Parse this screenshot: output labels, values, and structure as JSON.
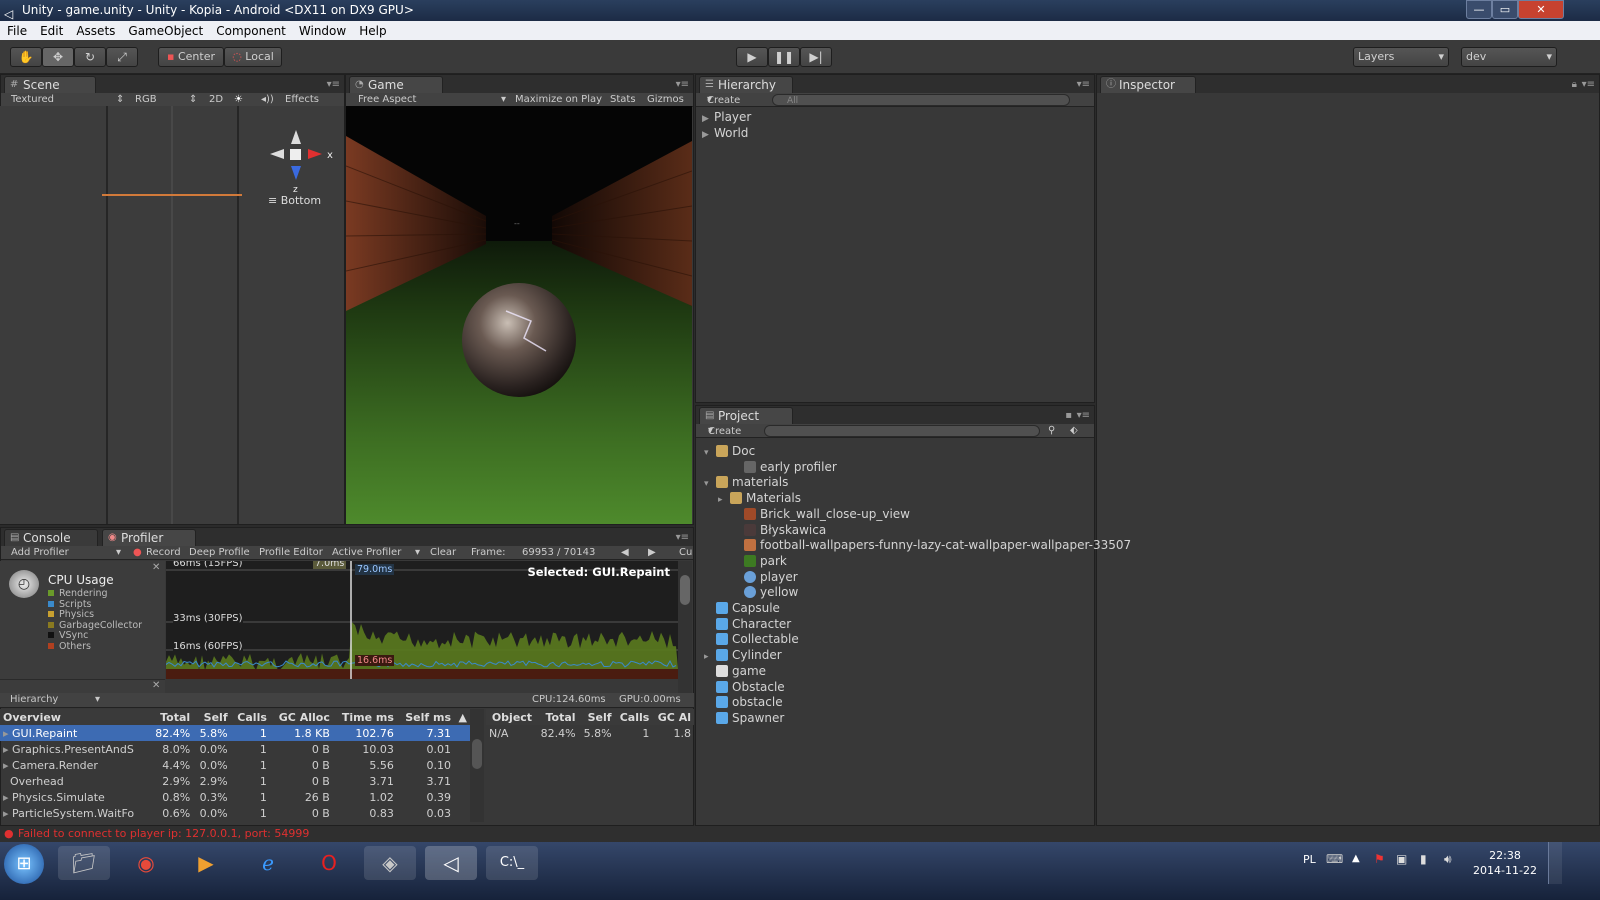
{
  "window": {
    "title": "Unity - game.unity - Unity - Kopia - Android <DX11 on DX9 GPU>",
    "buttons": {
      "minimize": "—",
      "maximize": "▭",
      "close": "✕"
    }
  },
  "menu": [
    "File",
    "Edit",
    "Assets",
    "GameObject",
    "Component",
    "Window",
    "Help"
  ],
  "toolbar": {
    "pivot": "Center",
    "space": "Local",
    "layers": "Layers",
    "layout": "dev"
  },
  "scene": {
    "tab": "Scene",
    "render_mode": "Textured",
    "color_mode": "RGB",
    "mode_2d": "2D",
    "effects": "Effects",
    "gizmo_label": "Bottom",
    "axis_x": "x",
    "axis_z": "z"
  },
  "game": {
    "tab": "Game",
    "aspect": "Free Aspect",
    "maximize": "Maximize on Play",
    "stats": "Stats",
    "gizmos": "Gizmos"
  },
  "hierarchy": {
    "tab": "Hierarchy",
    "create": "Create",
    "search_placeholder": "All",
    "items": [
      "Player",
      "World"
    ]
  },
  "inspector": {
    "tab": "Inspector"
  },
  "project": {
    "tab": "Project",
    "create": "Create",
    "items": [
      {
        "label": "Doc",
        "depth": 0,
        "type": "folder-open"
      },
      {
        "label": "early profiler",
        "depth": 2,
        "type": "file"
      },
      {
        "label": "materials",
        "depth": 0,
        "type": "folder-open"
      },
      {
        "label": "Materials",
        "depth": 1,
        "type": "folder-closed"
      },
      {
        "label": "Brick_wall_close-up_view",
        "depth": 2,
        "type": "texture-brick"
      },
      {
        "label": "Błyskawica",
        "depth": 2,
        "type": "texture-dark"
      },
      {
        "label": "football-wallpapers-funny-lazy-cat-wallpaper-wallpaper-33507",
        "depth": 2,
        "type": "texture-cat"
      },
      {
        "label": "park",
        "depth": 2,
        "type": "texture-grass"
      },
      {
        "label": "player",
        "depth": 2,
        "type": "material"
      },
      {
        "label": "yellow",
        "depth": 2,
        "type": "material"
      },
      {
        "label": "Capsule",
        "depth": 0,
        "type": "prefab"
      },
      {
        "label": "Character",
        "depth": 0,
        "type": "script"
      },
      {
        "label": "Collectable",
        "depth": 0,
        "type": "script"
      },
      {
        "label": "Cylinder",
        "depth": 0,
        "type": "prefab-collapsed"
      },
      {
        "label": "game",
        "depth": 0,
        "type": "scene"
      },
      {
        "label": "Obstacle",
        "depth": 0,
        "type": "script"
      },
      {
        "label": "obstacle",
        "depth": 0,
        "type": "prefab"
      },
      {
        "label": "Spawner",
        "depth": 0,
        "type": "script"
      }
    ]
  },
  "console": {
    "tab": "Console"
  },
  "profiler": {
    "tab": "Profiler",
    "add": "Add Profiler",
    "record": "Record",
    "deep": "Deep Profile",
    "editor": "Profile Editor",
    "active": "Active Profiler",
    "clear": "Clear",
    "frame_label": "Frame:",
    "frame_value": "69953 / 70143",
    "current": "Cu",
    "module": "CPU Usage",
    "legend": [
      {
        "label": "Rendering",
        "color": "#6a9a2a"
      },
      {
        "label": "Scripts",
        "color": "#3a8acb"
      },
      {
        "label": "Physics",
        "color": "#c8a030"
      },
      {
        "label": "GarbageCollector",
        "color": "#8a7a20"
      },
      {
        "label": "VSync",
        "color": "#111111"
      },
      {
        "label": "Others",
        "color": "#b04020"
      }
    ],
    "graph": {
      "line_66": "66ms (15FPS)",
      "line_33": "33ms (30FPS)",
      "line_16": "16ms (60FPS)",
      "marker_left": "7.0ms",
      "marker_right": "79.0ms",
      "marker_bottom": "16.6ms",
      "selected": "Selected: GUI.Repaint"
    },
    "view_mode": "Hierarchy",
    "cpu": "CPU:124.60ms",
    "gpu": "GPU:0.00ms",
    "columns": [
      "Overview",
      "Total",
      "Self",
      "Calls",
      "GC Alloc",
      "Time ms",
      "Self ms",
      "▲"
    ],
    "rows": [
      [
        "GUI.Repaint",
        "82.4%",
        "5.8%",
        "1",
        "1.8 KB",
        "102.76",
        "7.31"
      ],
      [
        "Graphics.PresentAndS",
        "8.0%",
        "0.0%",
        "1",
        "0 B",
        "10.03",
        "0.01"
      ],
      [
        "Camera.Render",
        "4.4%",
        "0.0%",
        "1",
        "0 B",
        "5.56",
        "0.10"
      ],
      [
        "Overhead",
        "2.9%",
        "2.9%",
        "1",
        "0 B",
        "3.71",
        "3.71"
      ],
      [
        "Physics.Simulate",
        "0.8%",
        "0.3%",
        "1",
        "26 B",
        "1.02",
        "0.39"
      ],
      [
        "ParticleSystem.WaitFo",
        "0.6%",
        "0.0%",
        "1",
        "0 B",
        "0.83",
        "0.03"
      ]
    ],
    "object_columns": [
      "Object",
      "Total",
      "Self",
      "Calls",
      "GC Al"
    ],
    "object_rows": [
      [
        "N/A",
        "82.4%",
        "5.8%",
        "1",
        "1.8"
      ]
    ]
  },
  "status": "Failed to connect to player ip: 127.0.0.1, port: 54999",
  "taskbar": {
    "lang": "PL",
    "time": "22:38",
    "date": "2014-11-22"
  }
}
